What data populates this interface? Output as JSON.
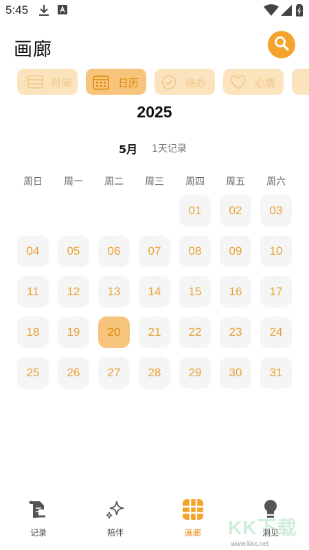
{
  "status_bar": {
    "time": "5:45"
  },
  "header": {
    "title": "画廊"
  },
  "tabs": [
    {
      "label": "时间",
      "icon": "timeline-icon",
      "active": false
    },
    {
      "label": "日历",
      "icon": "calendar-icon",
      "active": true
    },
    {
      "label": "待办",
      "icon": "check-circle-icon",
      "active": false
    },
    {
      "label": "心情",
      "icon": "heart-icon",
      "active": false
    }
  ],
  "calendar": {
    "year": "2025",
    "month": "5月",
    "record_count": "1天记录",
    "weekdays": [
      "周日",
      "周一",
      "周二",
      "周三",
      "周四",
      "周五",
      "周六"
    ],
    "days": [
      "01",
      "02",
      "03",
      "04",
      "05",
      "06",
      "07",
      "08",
      "09",
      "10",
      "11",
      "12",
      "13",
      "14",
      "15",
      "16",
      "17",
      "18",
      "19",
      "20",
      "21",
      "22",
      "23",
      "24",
      "25",
      "26",
      "27",
      "28",
      "29",
      "30",
      "31"
    ],
    "selected_day": "20"
  },
  "bottom_nav": [
    {
      "label": "记录",
      "icon": "notebook-icon",
      "active": false
    },
    {
      "label": "陪伴",
      "icon": "sparkle-icon",
      "active": false
    },
    {
      "label": "画廊",
      "icon": "grid-icon",
      "active": true
    },
    {
      "label": "洞见",
      "icon": "lightbulb-icon",
      "active": false
    }
  ],
  "watermark": {
    "text": "KK下载",
    "url": "www.kkx.net"
  },
  "colors": {
    "accent": "#f4a32c",
    "tab_bg": "#fbe3bd",
    "tab_active_bg": "#f6c47a",
    "day_text": "#e8a234"
  }
}
